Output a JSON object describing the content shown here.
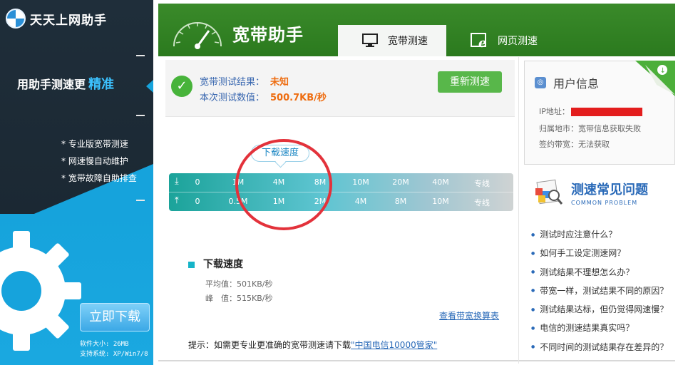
{
  "app": {
    "logo_text": "天天上网助手",
    "slogan": "用助手测速更",
    "slogan_highlight": "精准",
    "features": [
      "专业版宽带测速",
      "网速慢自动维护",
      "宽带故障自助排查"
    ],
    "download_button": "立即下载",
    "software_size": "软件大小: 26MB",
    "supported_os": "支持系统: XP/Win7/8"
  },
  "header": {
    "title": "宽带助手",
    "tabs": [
      {
        "label": "宽带测速",
        "icon": "monitor-icon",
        "active": true
      },
      {
        "label": "网页测速",
        "icon": "ie-icon",
        "active": false
      }
    ]
  },
  "result": {
    "label_result": "宽带测试结果：",
    "value_result": "未知",
    "label_value": "本次测试数值：",
    "value_speed": "500.7KB/秒",
    "retest_button": "重新测速"
  },
  "speed_scale": {
    "tooltip": "下载速度",
    "download_ticks": [
      "0",
      "1M",
      "4M",
      "8M",
      "10M",
      "20M",
      "40M",
      "专线"
    ],
    "upload_ticks": [
      "0",
      "0.5M",
      "1M",
      "2M",
      "4M",
      "8M",
      "10M",
      "专线"
    ]
  },
  "stats": {
    "title": "下载速度",
    "avg_label": "平均值：501KB/秒",
    "peak_label": "峰　值：515KB/秒",
    "formula_link": "查看带宽换算表",
    "hint_prefix": "提示：如需更专业更准确的宽带测速请下载",
    "hint_link": "\"中国电信10000管家\""
  },
  "user_info": {
    "title": "用户信息",
    "ip_label": "IP地址：",
    "location": "归属地市：宽带信息获取失败",
    "bandwidth": "签约带宽：无法获取"
  },
  "faq": {
    "title": "测速常见问题",
    "subtitle": "COMMON PROBLEM",
    "items": [
      "测试时应注意什么？",
      "如何手工设定测速网？",
      "测试结果不理想怎么办？",
      "带宽一样，测试结果不同的原因？",
      "测试结果达标，但仍觉得网速慢？",
      "电信的测速结果真实吗？",
      "不同时间的测试结果存在差异的？"
    ]
  },
  "colors": {
    "header_green": "#2b7a1e",
    "accent_blue": "#16a3dc",
    "result_orange": "#ee6c0f",
    "annotation_red": "#e3323b"
  }
}
